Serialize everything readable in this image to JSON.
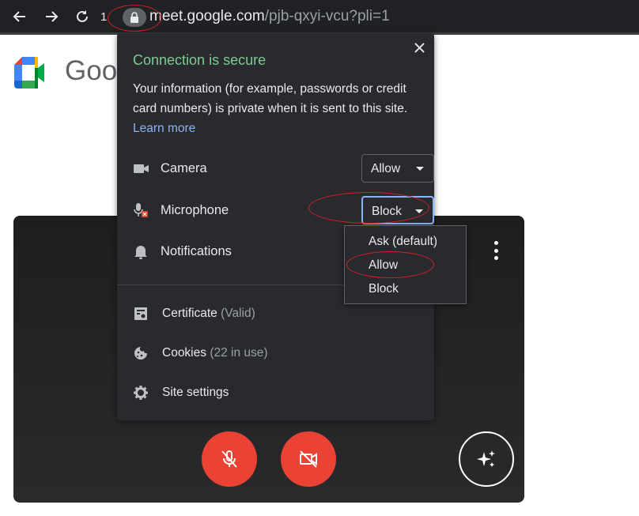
{
  "toolbar": {
    "truncated_char": "1",
    "url_domain": "meet.google.com",
    "url_path": "/pjb-qxyi-vcu?pli=1"
  },
  "page": {
    "brand_text": "Goog"
  },
  "popup": {
    "title": "Connection is secure",
    "description": "Your information (for example, passwords or credit card numbers) is private when it is sent to this site.",
    "learn_more": "Learn more",
    "permissions": [
      {
        "label": "Camera",
        "value": "Allow",
        "icon": "camera-icon"
      },
      {
        "label": "Microphone",
        "value": "Block",
        "icon": "microphone-blocked-icon"
      },
      {
        "label": "Notifications",
        "icon": "bell-icon"
      }
    ],
    "info_rows": [
      {
        "label": "Certificate",
        "sub": "(Valid)",
        "icon": "certificate-icon"
      },
      {
        "label": "Cookies",
        "sub": "(22 in use)",
        "icon": "cookie-icon"
      },
      {
        "label": "Site settings",
        "sub": "",
        "icon": "gear-icon"
      }
    ]
  },
  "dropdown": {
    "options": [
      "Ask (default)",
      "Allow",
      "Block"
    ]
  },
  "colors": {
    "secure_green": "#81c995",
    "link_blue": "#8ab4f8",
    "danger_red": "#ea4335",
    "annotation_red": "#d0202a"
  }
}
